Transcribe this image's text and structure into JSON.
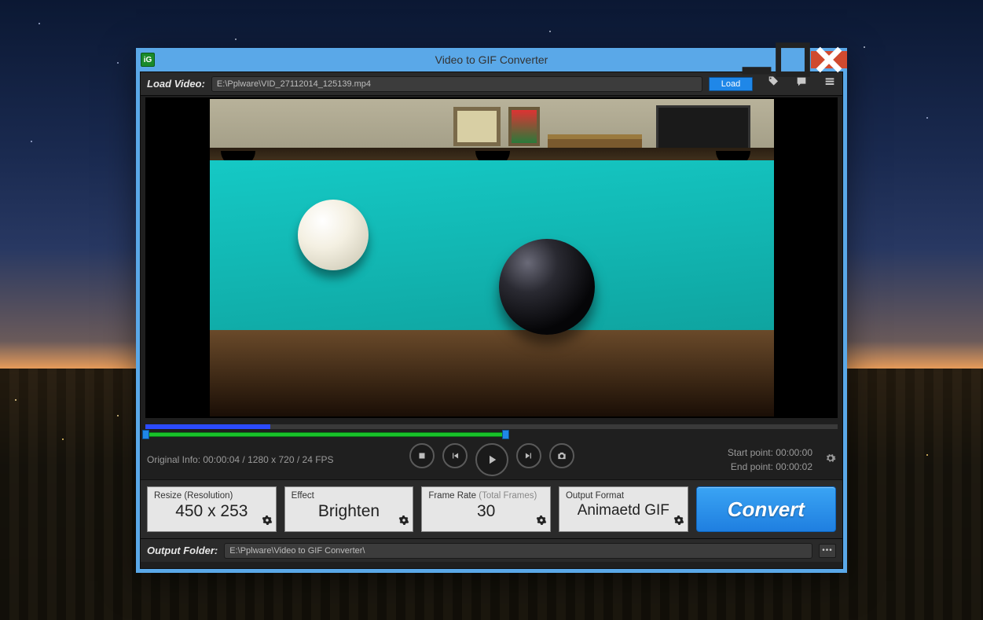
{
  "window": {
    "title": "Video to GIF Converter",
    "app_icon_text": "iG"
  },
  "topbar": {
    "load_label": "Load Video:",
    "video_path": "E:\\Pplware\\VID_27112014_125139.mp4",
    "load_button": "Load"
  },
  "timeline": {
    "progress_pct": 18,
    "range_start_pct": 0,
    "range_end_pct": 52
  },
  "info": {
    "original_prefix": "Original Info: ",
    "duration": "00:00:04",
    "resolution": "1280 x 720",
    "fps": "24 FPS"
  },
  "points": {
    "start_label": "Start point: ",
    "start_value": "00:00:00",
    "end_label": "End point: ",
    "end_value": "00:00:02"
  },
  "cards": {
    "resize": {
      "title": "Resize (Resolution)",
      "value": "450 x 253"
    },
    "effect": {
      "title": "Effect",
      "value": "Brighten"
    },
    "framerate": {
      "title": "Frame Rate ",
      "subtitle": "(Total Frames)",
      "value": "30"
    },
    "format": {
      "title": "Output Format",
      "value": "Animaetd GIF"
    }
  },
  "convert_label": "Convert",
  "output": {
    "label": "Output Folder:",
    "path": "E:\\Pplware\\Video to GIF Converter\\",
    "browse": "•••"
  }
}
